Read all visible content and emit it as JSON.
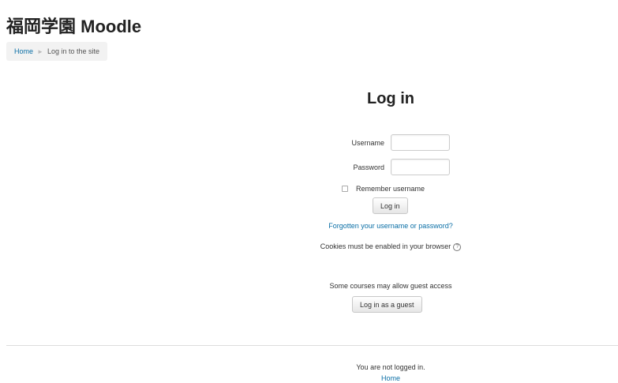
{
  "header": {
    "site_title": "福岡学園 Moodle"
  },
  "breadcrumb": {
    "home": "Home",
    "separator": "►",
    "current": "Log in to the site"
  },
  "login": {
    "heading": "Log in",
    "username_label": "Username",
    "username_value": "",
    "password_label": "Password",
    "password_value": "",
    "remember_label": "Remember username",
    "remember_checked": false,
    "login_button": "Log in",
    "forgot_link": "Forgotten your username or password?",
    "cookies_text": "Cookies must be enabled in your browser",
    "help_icon": "?"
  },
  "guest": {
    "text": "Some courses may allow guest access",
    "button": "Log in as a guest"
  },
  "footer": {
    "status": "You are not logged in.",
    "home_link": "Home"
  },
  "colors": {
    "link": "#0b6fa6",
    "text": "#333333",
    "title": "#222222",
    "breadcrumb_bg": "#f2f2f2"
  }
}
